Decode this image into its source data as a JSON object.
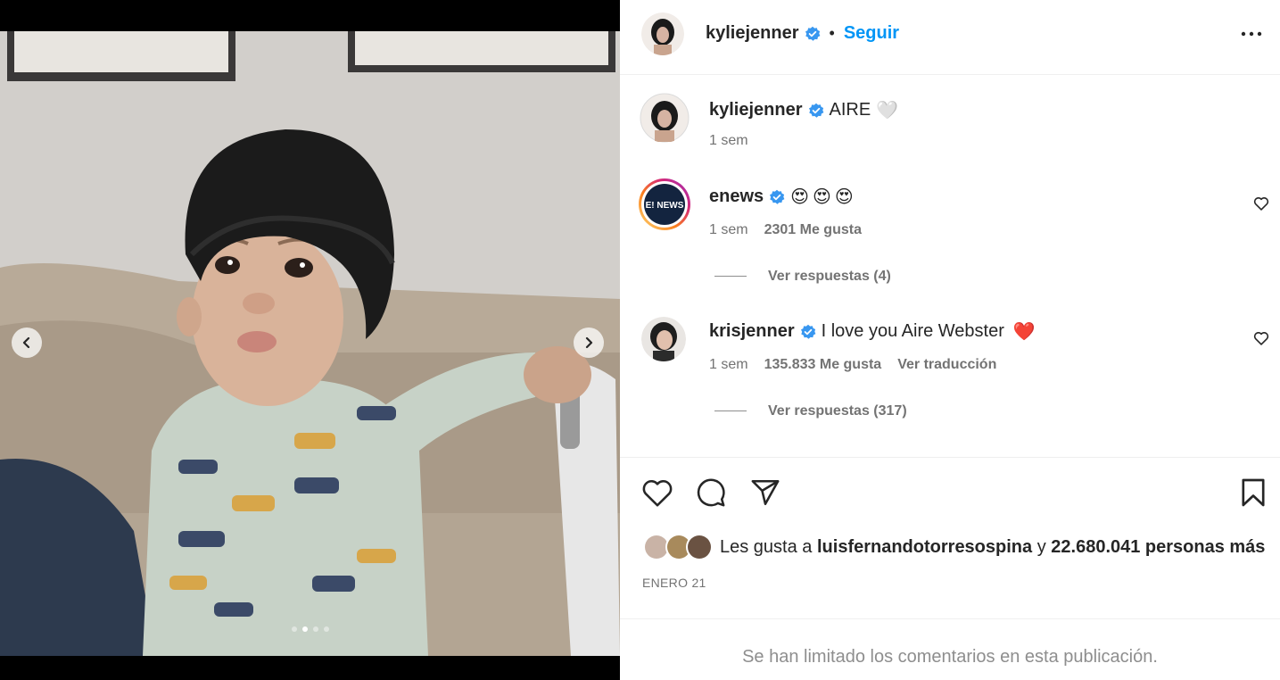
{
  "header": {
    "username": "kyliejenner",
    "separator": "•",
    "follow_label": "Seguir",
    "more_icon": "more-horizontal-icon"
  },
  "caption": {
    "username": "kyliejenner",
    "text": "AIRE",
    "emoji": "🤍",
    "time": "1 sem"
  },
  "comments": [
    {
      "username": "enews",
      "avatar_text": "E! NEWS",
      "text": "😍😍😍",
      "time": "1 sem",
      "likes": "2301 Me gusta",
      "replies": "Ver respuestas (4)"
    },
    {
      "username": "krisjenner",
      "text": "I love you Aire Webster",
      "emoji": "❤️",
      "time": "1 sem",
      "likes": "135.833 Me gusta",
      "translate": "Ver traducción",
      "replies": "Ver respuestas (317)"
    }
  ],
  "likes": {
    "prefix": "Les gusta a",
    "user": "luisfernandotorresospina",
    "conj": "y",
    "others": "22.680.041 personas más"
  },
  "date": "ENERO 21",
  "footer": {
    "limited": "Se han limitado los comentarios en esta publicación."
  },
  "carousel": {
    "slide_count": 4,
    "active_index": 1
  },
  "colors": {
    "accent": "#0095f6",
    "verified": "#3897f0",
    "muted": "#737373"
  }
}
